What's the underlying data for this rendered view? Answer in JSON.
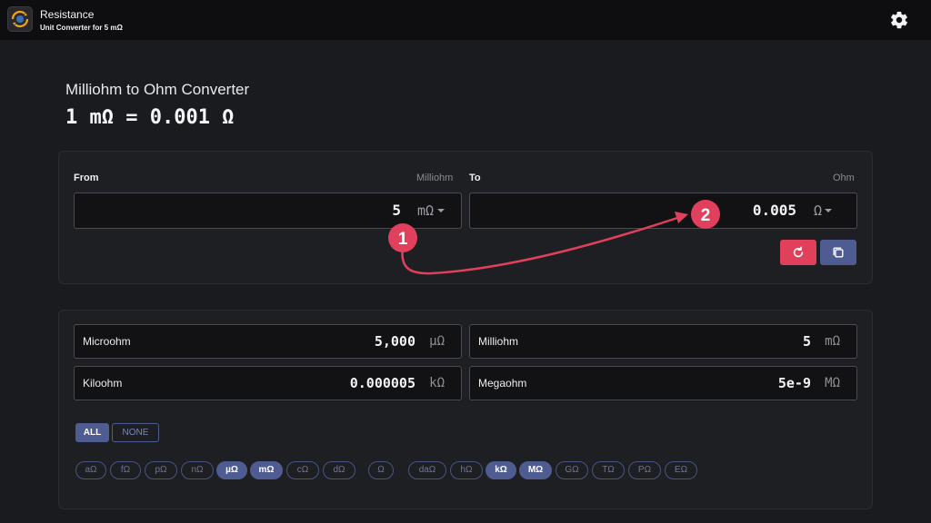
{
  "app": {
    "title": "Resistance",
    "subtitle": "Unit Converter for 5 mΩ"
  },
  "header": {
    "heading": "Milliohm to Ohm Converter",
    "formula": "1 mΩ = 0.001 Ω"
  },
  "converter": {
    "from_label": "From",
    "from_unit_name": "Milliohm",
    "from_value": "5",
    "from_symbol": "mΩ",
    "to_label": "To",
    "to_unit_name": "Ohm",
    "to_value": "0.005",
    "to_symbol": "Ω"
  },
  "results": [
    {
      "name": "Microohm",
      "value": "5,000",
      "symbol": "µΩ"
    },
    {
      "name": "Milliohm",
      "value": "5",
      "symbol": "mΩ"
    },
    {
      "name": "Kiloohm",
      "value": "0.000005",
      "symbol": "kΩ"
    },
    {
      "name": "Megaohm",
      "value": "5e-9",
      "symbol": "MΩ"
    }
  ],
  "filters": {
    "all_label": "ALL",
    "none_label": "NONE",
    "units": [
      {
        "label": "aΩ",
        "selected": false
      },
      {
        "label": "fΩ",
        "selected": false
      },
      {
        "label": "pΩ",
        "selected": false
      },
      {
        "label": "nΩ",
        "selected": false
      },
      {
        "label": "µΩ",
        "selected": true
      },
      {
        "label": "mΩ",
        "selected": true
      },
      {
        "label": "cΩ",
        "selected": false
      },
      {
        "label": "dΩ",
        "selected": false
      },
      {
        "label": "Ω",
        "selected": false
      },
      {
        "label": "daΩ",
        "selected": false
      },
      {
        "label": "hΩ",
        "selected": false
      },
      {
        "label": "kΩ",
        "selected": true
      },
      {
        "label": "MΩ",
        "selected": true
      },
      {
        "label": "GΩ",
        "selected": false
      },
      {
        "label": "TΩ",
        "selected": false
      },
      {
        "label": "PΩ",
        "selected": false
      },
      {
        "label": "EΩ",
        "selected": false
      }
    ]
  },
  "annotations": {
    "marker_1": "1",
    "marker_2": "2",
    "color": "#e0405c"
  },
  "colors": {
    "accent": "#4f5c92",
    "danger": "#e0405c",
    "background": "#1a1b1f"
  }
}
